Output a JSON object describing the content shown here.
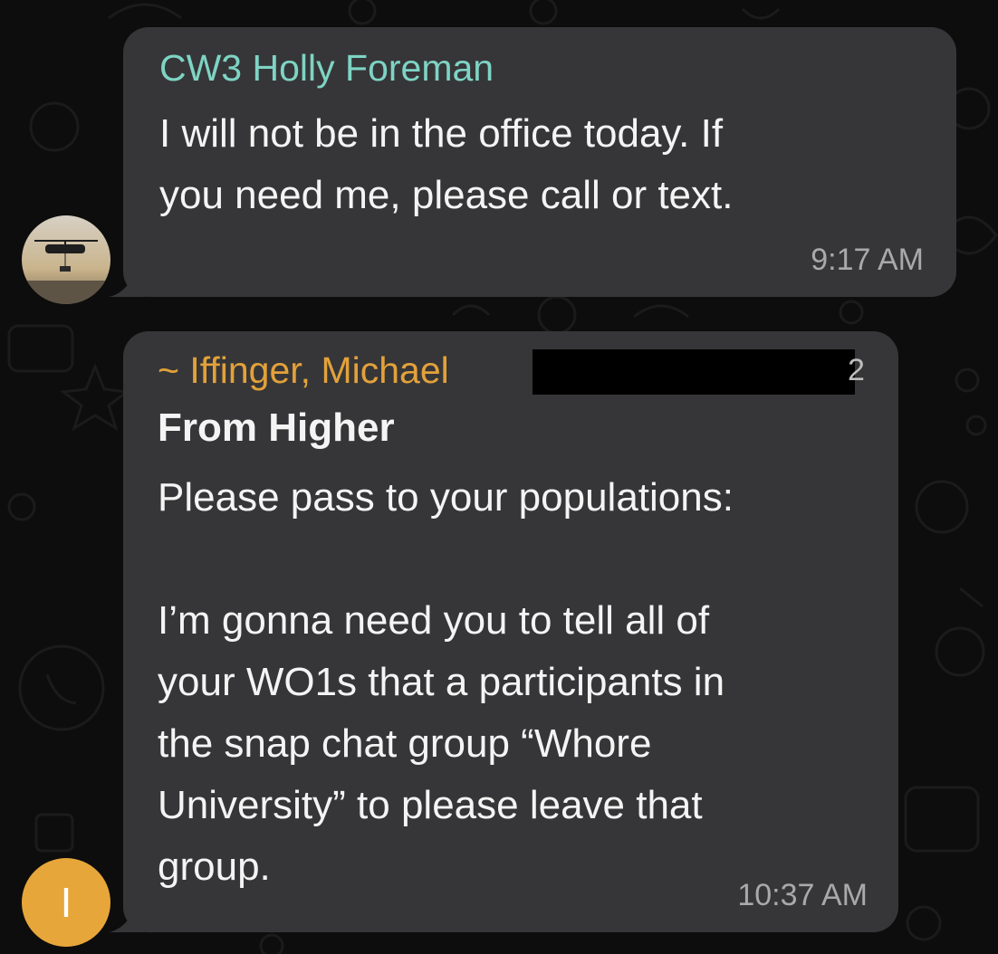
{
  "messages": [
    {
      "sender": "CW3 Holly Foreman",
      "text": "I will not be in the office today. If\nyou need me, please call or text.",
      "time": "9:17 AM",
      "avatar": {
        "type": "photo",
        "icon": "helicopter-photo-icon"
      },
      "sender_color": "#7ed4c4"
    },
    {
      "sender": "~ Iffinger, Michael",
      "redacted_trailing_char": "2",
      "subject": "From Higher",
      "text": "Please pass to your populations:\n\nI’m gonna need you to tell all of\nyour WO1s that a participants in\nthe snap chat group “Whore\nUniversity” to please leave that\ngroup.",
      "time": "10:37 AM",
      "avatar": {
        "type": "initial",
        "initial": "I",
        "color": "#e7a63a"
      },
      "sender_color": "#e3a13a"
    }
  ],
  "colors": {
    "bubble": "#363638",
    "background": "#0d0d0d",
    "timestamp": "#a9a9ab"
  }
}
